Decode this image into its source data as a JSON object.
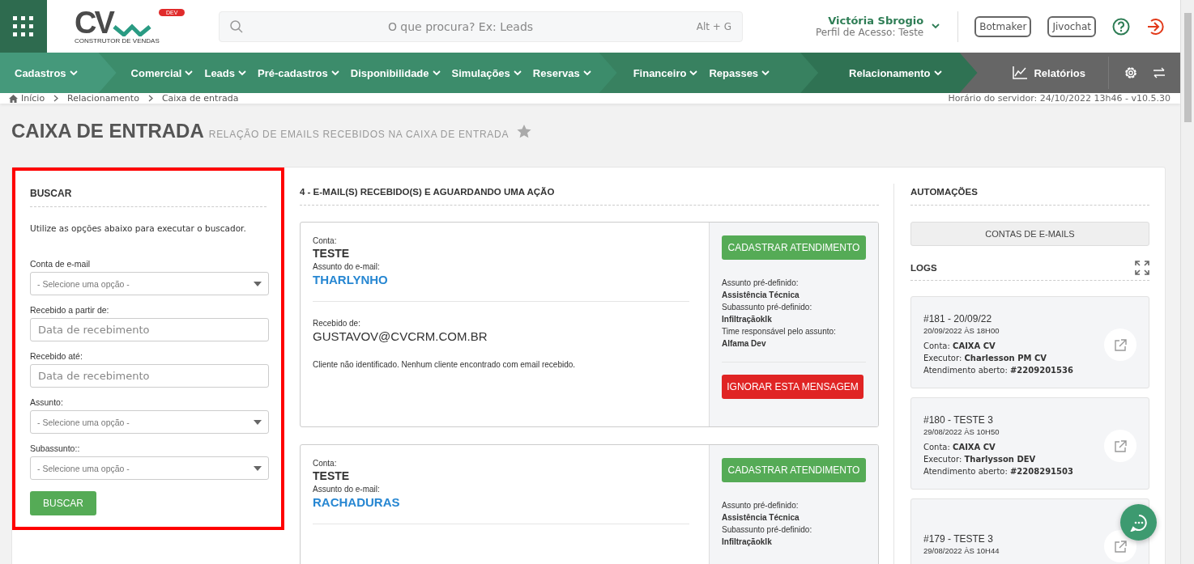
{
  "logo": {
    "letters": "CV",
    "badge": "DEV",
    "tagline": "CONSTRUTOR DE VENDAS"
  },
  "header": {
    "search_placeholder": "O que procura? Ex: Leads",
    "shortcut": "Alt + G",
    "user_name": "Victória Sbrogio",
    "user_profile": "Perfil de Acesso: Teste",
    "buttons": [
      "Botmaker",
      "Jivochat"
    ]
  },
  "nav": {
    "groups": [
      [
        "Cadastros"
      ],
      [
        "Comercial",
        "Leads",
        "Pré-cadastros",
        "Disponibilidade",
        "Simulações",
        "Reservas"
      ],
      [
        "Financeiro",
        "Repasses"
      ],
      [
        "Relacionamento"
      ]
    ],
    "reports": "Relatórios"
  },
  "breadcrumb": {
    "items": [
      "Início",
      "Relacionamento",
      "Caixa de entrada"
    ],
    "server_time": "Horário do servidor: 24/10/2022 13h46 - v10.5.30"
  },
  "page": {
    "title": "CAIXA DE ENTRADA",
    "subtitle": "RELAÇÃO DE EMAILS RECEBIDOS NA CAIXA DE ENTRADA",
    "favorite": false
  },
  "search_panel": {
    "highlighted": true,
    "title": "BUSCAR",
    "hint": "Utilize as opções abaixo para executar o buscador.",
    "fields": [
      {
        "kind": "select",
        "label": "Conta de e-mail",
        "placeholder": "- Selecione uma opção -"
      },
      {
        "kind": "date",
        "label": "Recebido a partir de:",
        "placeholder": "Data de recebimento"
      },
      {
        "kind": "date",
        "label": "Recebido até:",
        "placeholder": "Data de recebimento"
      },
      {
        "kind": "select",
        "label": "Assunto:",
        "placeholder": "- Selecione uma opção -"
      },
      {
        "kind": "select",
        "label": "Subassunto::",
        "placeholder": "- Selecione uma opção -"
      }
    ],
    "button": "BUSCAR"
  },
  "emails": {
    "title": "4 - E-MAIL(S) RECEBIDO(S) E AGUARDANDO UMA AÇÃO",
    "items": [
      {
        "account_label": "Conta:",
        "account": "TESTE",
        "subject_label": "Assunto do e-mail:",
        "subject": "THARLYNHO",
        "sender_label": "Recebido de:",
        "sender": "GUSTAVOV@CVCRM.COM.BR",
        "note": "Cliente não identificado. Nenhum cliente encontrado com email recebido.",
        "register_button": "CADASTRAR ATENDIMENTO",
        "details": [
          {
            "label": "Assunto pré-definido:",
            "value": "Assistência Técnica"
          },
          {
            "label": "Subassunto pré-definido:",
            "value": "Infiltraçãoklk"
          },
          {
            "label": "Time responsável pelo assunto:",
            "value": "Alfama Dev"
          }
        ],
        "ignore_button": "IGNORAR ESTA MENSAGEM"
      },
      {
        "account_label": "Conta:",
        "account": "TESTE",
        "subject_label": "Assunto do e-mail:",
        "subject": "RACHADURAS",
        "register_button": "CADASTRAR ATENDIMENTO",
        "details": [
          {
            "label": "Assunto pré-definido:",
            "value": "Assistência Técnica"
          },
          {
            "label": "Subassunto pré-definido:",
            "value": "Infiltraçãoklk"
          }
        ]
      }
    ]
  },
  "automations": {
    "title": "AUTOMAÇÕES",
    "accounts_button": "CONTAS DE E-MAILS",
    "logs_title": "LOGS",
    "logs": [
      {
        "title": "#181 - 20/09/22",
        "date": "20/09/2022 ÀS 18H00",
        "fields": [
          "Conta: **CAIXA CV**",
          "Executor: **Charlesson PM CV**",
          "Atendimento aberto: **#2209201536**"
        ]
      },
      {
        "title": "#180 - TESTE 3",
        "date": "29/08/2022 ÀS 10H50",
        "fields": [
          "Conta: **CAIXA CV**",
          "Executor: **Tharlysson DEV**",
          "Atendimento aberto: **#2208291503**"
        ]
      },
      {
        "title": "#179 - TESTE 3",
        "date": "29/08/2022 ÀS 10H44"
      }
    ]
  }
}
